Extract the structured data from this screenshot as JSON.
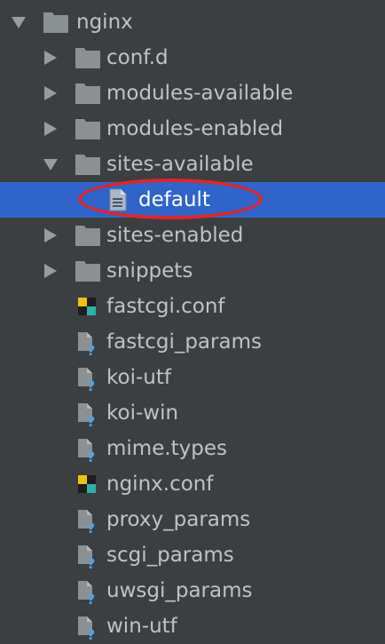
{
  "tree": {
    "items": [
      {
        "label": "nginx",
        "type": "folder",
        "arrow": "down",
        "depth": 0
      },
      {
        "label": "conf.d",
        "type": "folder",
        "arrow": "right",
        "depth": 1
      },
      {
        "label": "modules-available",
        "type": "folder",
        "arrow": "right",
        "depth": 1
      },
      {
        "label": "modules-enabled",
        "type": "folder",
        "arrow": "right",
        "depth": 1
      },
      {
        "label": "sites-available",
        "type": "folder",
        "arrow": "down",
        "depth": 1
      },
      {
        "label": "default",
        "type": "text-file",
        "arrow": "none",
        "depth": 2,
        "selected": true
      },
      {
        "label": "sites-enabled",
        "type": "folder",
        "arrow": "right",
        "depth": 1
      },
      {
        "label": "snippets",
        "type": "folder",
        "arrow": "right",
        "depth": 1
      },
      {
        "label": "fastcgi.conf",
        "type": "config-file",
        "arrow": "none",
        "depth": 1
      },
      {
        "label": "fastcgi_params",
        "type": "unknown-file",
        "arrow": "none",
        "depth": 1
      },
      {
        "label": "koi-utf",
        "type": "unknown-file",
        "arrow": "none",
        "depth": 1
      },
      {
        "label": "koi-win",
        "type": "unknown-file",
        "arrow": "none",
        "depth": 1
      },
      {
        "label": "mime.types",
        "type": "unknown-file",
        "arrow": "none",
        "depth": 1
      },
      {
        "label": "nginx.conf",
        "type": "config-file",
        "arrow": "none",
        "depth": 1
      },
      {
        "label": "proxy_params",
        "type": "unknown-file",
        "arrow": "none",
        "depth": 1
      },
      {
        "label": "scgi_params",
        "type": "unknown-file",
        "arrow": "none",
        "depth": 1
      },
      {
        "label": "uwsgi_params",
        "type": "unknown-file",
        "arrow": "none",
        "depth": 1
      },
      {
        "label": "win-utf",
        "type": "unknown-file",
        "arrow": "none",
        "depth": 1
      }
    ]
  },
  "colors": {
    "background": "#3c3f41",
    "selection": "#2f65ca",
    "folder": "#8b9093",
    "annotation": "#e0252a"
  }
}
